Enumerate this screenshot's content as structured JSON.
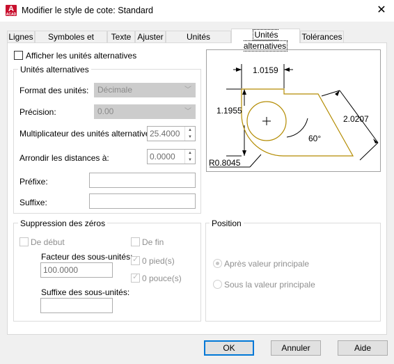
{
  "window": {
    "title": "Modifier le style de cote: Standard",
    "app_icon_letter": "A",
    "app_icon_sub": "ACAD",
    "close_glyph": "✕"
  },
  "tabs": [
    {
      "label": "Lignes"
    },
    {
      "label": "Symboles et flèches"
    },
    {
      "label": "Texte"
    },
    {
      "label": "Ajuster"
    },
    {
      "label": "Unités principales"
    },
    {
      "label": "Unités alternatives",
      "active": true
    },
    {
      "label": "Tolérances"
    }
  ],
  "show_alt": {
    "label": "Afficher les unités alternatives",
    "checked": false
  },
  "alt_units": {
    "legend": "Unités alternatives",
    "format_label": "Format des unités:",
    "format_value": "Décimale",
    "precision_label": "Précision:",
    "precision_value": "0.00",
    "multiplier_label": "Multiplicateur des unités alternatives:",
    "multiplier_value": "25.4000",
    "round_label": "Arrondir les distances à:",
    "round_value": "0.0000",
    "prefix_label": "Préfixe:",
    "prefix_value": "",
    "suffix_label": "Suffixe:",
    "suffix_value": ""
  },
  "zeros": {
    "legend": "Suppression des zéros",
    "leading_label": "De début",
    "trailing_label": "De fin",
    "subunit_factor_label": "Facteur des sous-unités:",
    "subunit_factor_value": "100.0000",
    "subunit_suffix_label": "Suffixe des sous-unités:",
    "subunit_suffix_value": "",
    "feet_label": "0 pied(s)",
    "feet_checked": true,
    "inches_label": "0 pouce(s)",
    "inches_checked": true
  },
  "position": {
    "legend": "Position",
    "after_label": "Après valeur principale",
    "after_selected": true,
    "below_label": "Sous la valeur principale",
    "below_selected": false
  },
  "preview": {
    "dim_top": "1.0159",
    "dim_left": "1.1955",
    "dim_right": "2.0207",
    "angle": "60°",
    "radius": "R0.8045"
  },
  "buttons": {
    "ok": "OK",
    "cancel": "Annuler",
    "help": "Aide"
  },
  "colors": {
    "accent": "#0078d7",
    "app_red": "#c8102e",
    "preview_outline": "#b38b00"
  }
}
